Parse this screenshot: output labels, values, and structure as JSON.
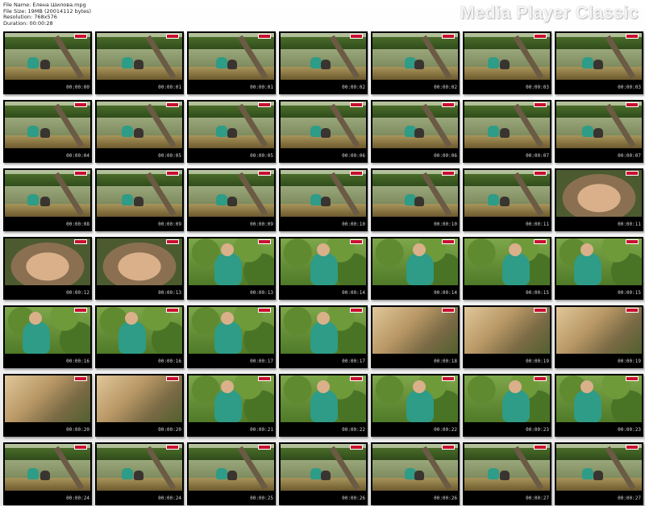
{
  "header": {
    "file_name": "File Name: Елена Шилова.mpg",
    "file_size": "File Size: 19MB (20014112 bytes)",
    "resolution": "Resolution: 768x576",
    "duration": "Duration: 00:00:28",
    "brand": "Media Player Classic"
  },
  "colors": {
    "brand_text": "#f5f5f5",
    "thumb_border": "#000000",
    "timestamp": "#d8d8d8"
  },
  "timestamps": [
    "00:00:00",
    "00:00:01",
    "00:00:01",
    "00:00:02",
    "00:00:02",
    "00:00:03",
    "00:00:03",
    "00:00:04",
    "00:00:05",
    "00:00:05",
    "00:00:06",
    "00:00:06",
    "00:00:07",
    "00:00:07",
    "00:00:08",
    "00:00:09",
    "00:00:09",
    "00:00:10",
    "00:00:10",
    "00:00:11",
    "00:00:11",
    "00:00:12",
    "00:00:13",
    "00:00:13",
    "00:00:14",
    "00:00:14",
    "00:00:15",
    "00:00:15",
    "00:00:16",
    "00:00:16",
    "00:00:17",
    "00:00:17",
    "00:00:18",
    "00:00:19",
    "00:00:19",
    "00:00:20",
    "00:00:20",
    "00:00:21",
    "00:00:22",
    "00:00:22",
    "00:00:23",
    "00:00:23",
    "00:00:24",
    "00:00:24",
    "00:00:25",
    "00:00:26",
    "00:00:26",
    "00:00:27",
    "00:00:27"
  ],
  "scenes": [
    "lake",
    "lake",
    "lake",
    "lake",
    "lake",
    "lake",
    "lake",
    "lake",
    "lake",
    "lake",
    "lake",
    "lake",
    "lake",
    "lake",
    "lake",
    "lake",
    "lake",
    "lake",
    "lake",
    "lake",
    "close",
    "close",
    "close",
    "leafy",
    "leafy",
    "leafy",
    "leafy",
    "leafy",
    "leafy",
    "leafy",
    "leafy",
    "leafy",
    "hair",
    "hair",
    "hair",
    "hair",
    "hair",
    "leafy",
    "leafy",
    "leafy",
    "leafy",
    "leafy",
    "lake",
    "lake",
    "lake",
    "lake",
    "lake",
    "lake",
    "lake"
  ]
}
